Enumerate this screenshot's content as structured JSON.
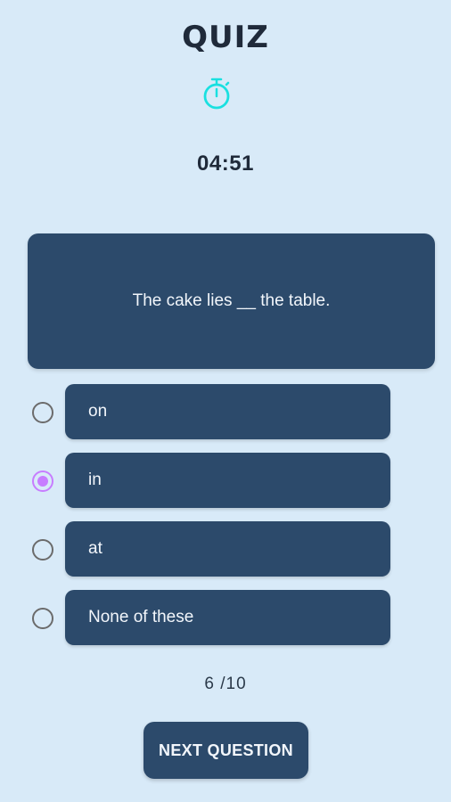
{
  "header": {
    "title": "QUIZ",
    "timer_icon": "stopwatch-icon",
    "timer_icon_color": "#19e0e0",
    "timer": "04:51"
  },
  "question": {
    "text": "The cake lies __ the table."
  },
  "options": [
    {
      "label": "on",
      "selected": false
    },
    {
      "label": "in",
      "selected": true
    },
    {
      "label": "at",
      "selected": false
    },
    {
      "label": "None of these",
      "selected": false
    }
  ],
  "progress": {
    "current": "6",
    "total": "/10"
  },
  "footer": {
    "next_label": "NEXT QUESTION"
  },
  "colors": {
    "background": "#d8eaf8",
    "card": "#2c4a6b",
    "selected_radio": "#c77dff"
  }
}
